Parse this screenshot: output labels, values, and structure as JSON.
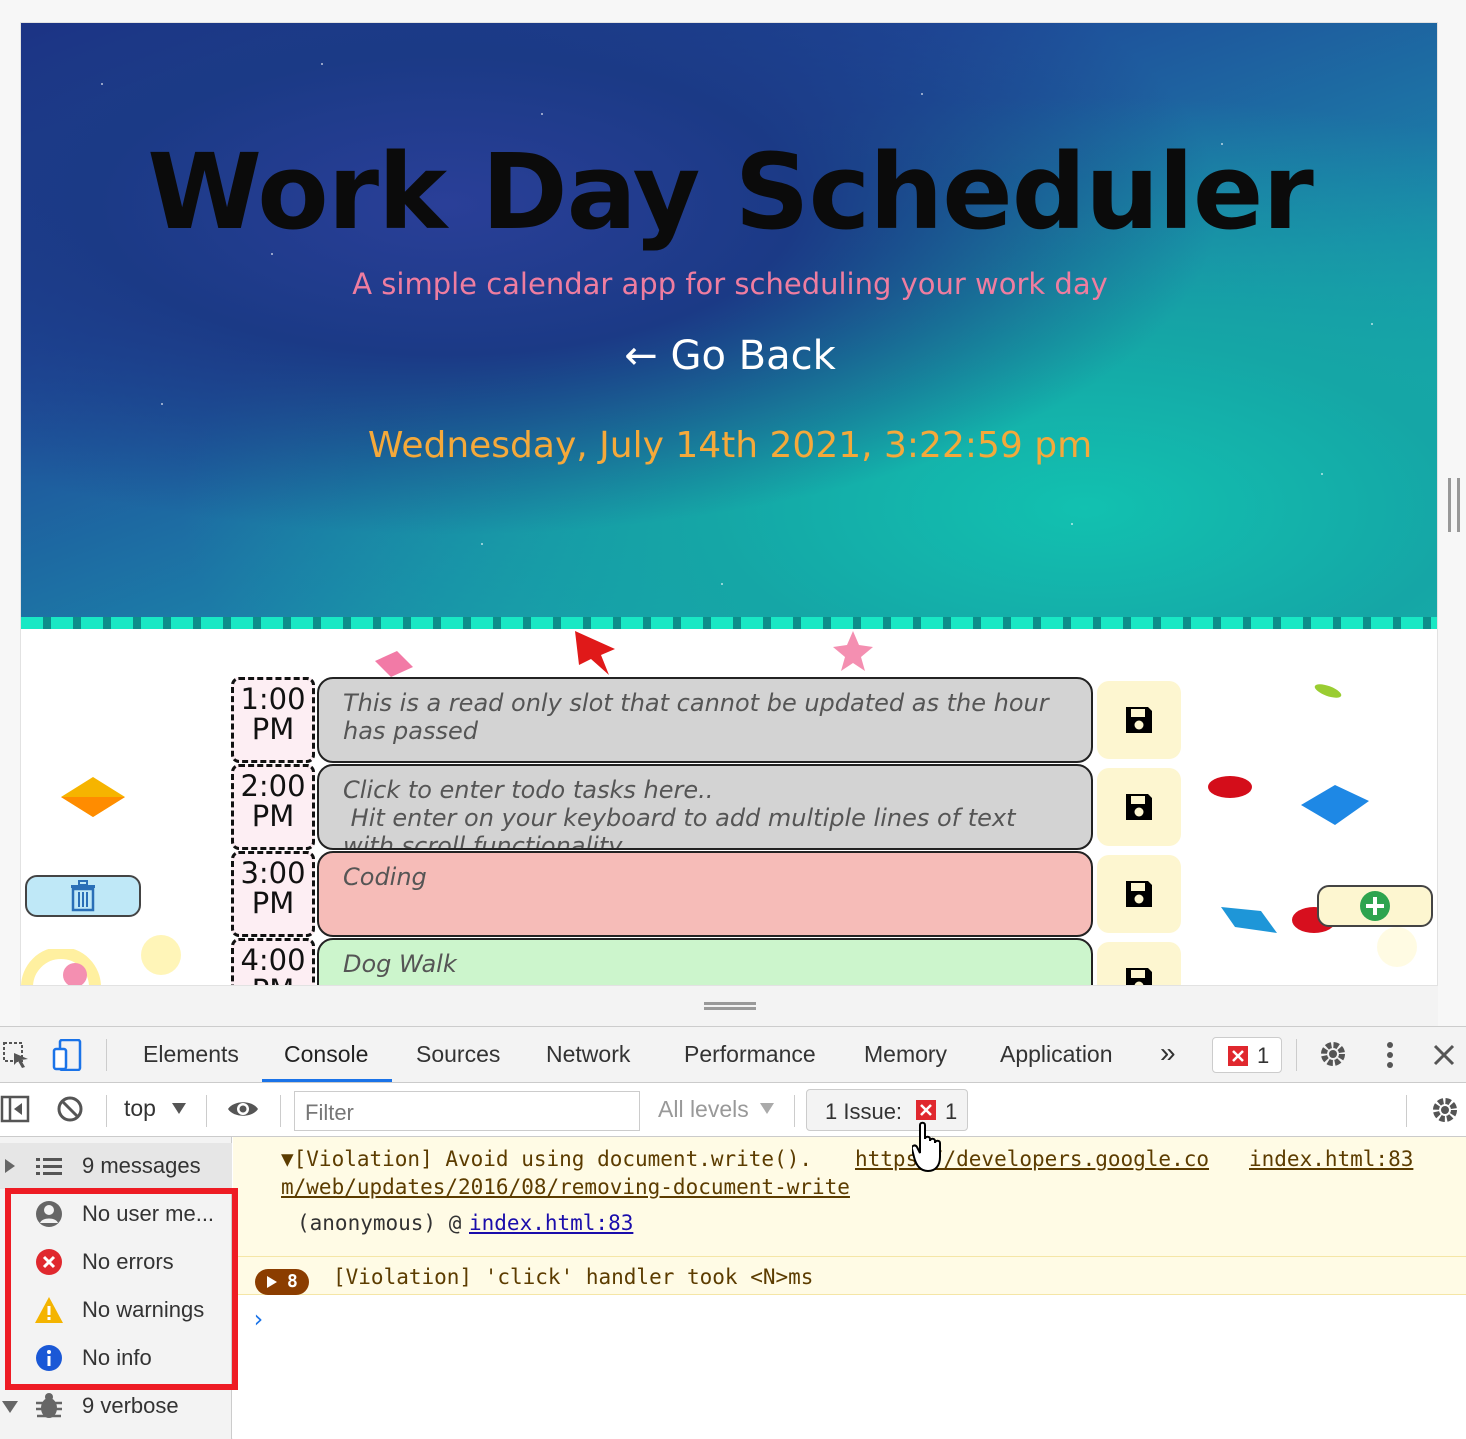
{
  "page": {
    "title": "Work Day Scheduler",
    "subtitle": "A simple calendar app for scheduling your work day",
    "go_back": "← Go Back",
    "datetime": "Wednesday, July 14th 2021, 3:22:59 pm",
    "rows": [
      {
        "hour": "1:00",
        "ampm": "PM",
        "text": "This is a read only slot that cannot be updated as the hour has passed",
        "state": "past"
      },
      {
        "hour": "2:00",
        "ampm": "PM",
        "text": "Click to enter todo tasks here..\n Hit enter on your keyboard to add multiple lines of text with scroll functionality",
        "state": "past"
      },
      {
        "hour": "3:00",
        "ampm": "PM",
        "text": "Coding",
        "state": "present"
      },
      {
        "hour": "4:00",
        "ampm": "PM",
        "text": "Dog Walk",
        "state": "future"
      }
    ]
  },
  "devtools": {
    "tabs": [
      "Elements",
      "Console",
      "Sources",
      "Network",
      "Performance",
      "Memory",
      "Application"
    ],
    "active_tab": "Console",
    "more_tabs": "»",
    "issue_count_badge": "1",
    "toolbar": {
      "context": "top",
      "filter_placeholder": "Filter",
      "levels": "All levels",
      "issues_label": "1 Issue:",
      "issues_count": "1"
    },
    "sidebar": [
      {
        "label": "9 messages",
        "icon": "list-icon"
      },
      {
        "label": "No user me...",
        "icon": "user-icon"
      },
      {
        "label": "No errors",
        "icon": "error-icon"
      },
      {
        "label": "No warnings",
        "icon": "warning-icon"
      },
      {
        "label": "No info",
        "icon": "info-icon"
      },
      {
        "label": "9 verbose",
        "icon": "bug-icon"
      }
    ],
    "messages": {
      "violation_line1_prefix": "▼[Violation] Avoid using document.write().",
      "violation_link_a": "https://developers.google.co",
      "violation_link_b": "m/web/updates/2016/08/removing-document-write",
      "violation_source": "index.html:83",
      "stack_prefix": "(anonymous) @",
      "stack_link": "index.html:83",
      "group_count": "8",
      "click_violation": "[Violation] 'click' handler took <N>ms"
    },
    "colors": {
      "highlight_box": "#ee1c24",
      "accent": "#1a73e8"
    }
  }
}
